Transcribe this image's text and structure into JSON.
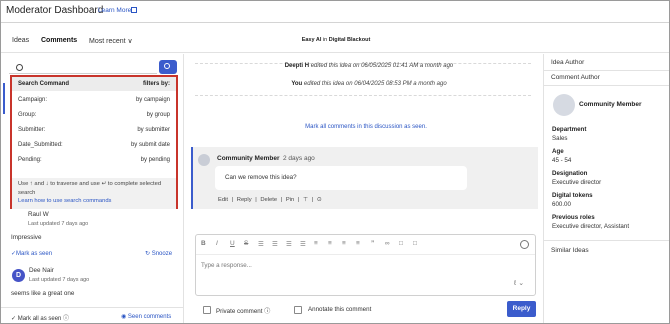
{
  "header": {
    "title": "Moderator Dashboard",
    "learn_more": "Learn More"
  },
  "tabs": {
    "ideas": "Ideas",
    "comments": "Comments",
    "sort": "Most recent ∨"
  },
  "document": {
    "owner": "Easy AI",
    "separator": "in",
    "title": "Digital Blackout"
  },
  "search_dropdown": {
    "header_left": "Search Command",
    "header_right": "filters by:",
    "rows": [
      {
        "command": "Campaign:",
        "filter": "by campaign"
      },
      {
        "command": "Group:",
        "filter": "by group"
      },
      {
        "command": "Submitter:",
        "filter": "by submitter"
      },
      {
        "command": "Date_Submitted:",
        "filter": "by submit date"
      },
      {
        "command": "Pending:",
        "filter": "by pending"
      }
    ],
    "hint": "Use ↑ and ↓ to traverse and use ↵ to complete selected search",
    "learn_link": "Learn how to use search commands"
  },
  "left_list": {
    "item1_name": "Raul W",
    "item1_updated": "Last updated 7 days ago",
    "item1_text": "Impressive",
    "mark_seen": "Mark as seen",
    "snooze": "Snooze",
    "item2_initial": "D",
    "item2_name": "Dee Nair",
    "item2_updated": "Last updated 7 days ago",
    "item2_text": "seems like a great one",
    "mark_all_seen": "Mark all as seen",
    "seen_comments": "Seen comments"
  },
  "activity": [
    {
      "who": "Deepti H",
      "text": "edited this idea on 06/05/2025 01:41 AM a month ago"
    },
    {
      "who": "You",
      "text": "edited this idea on 06/04/2025 08:53 PM a month ago"
    }
  ],
  "mark_all_discussion": "Mark all comments in this discussion as seen.",
  "comment": {
    "author": "Community Member",
    "time": "2 days ago",
    "text": "Can we remove this idea?",
    "actions": [
      "Edit",
      "|",
      "Reply",
      "|",
      "Delete",
      "|",
      "Pin",
      "|",
      "⊤",
      "|",
      "⊙"
    ]
  },
  "editor": {
    "placeholder": "Type a response...",
    "toolbar": [
      "B",
      "I",
      "U",
      "S",
      "☰",
      "☰",
      "☰",
      "☰",
      "≡",
      "≡",
      "≡",
      "≡",
      "”",
      "∞",
      "□",
      "□"
    ]
  },
  "options": {
    "private_comment": "Private comment",
    "annotate": "Annotate this comment",
    "reply": "Reply"
  },
  "right_panel": {
    "idea_author": "Idea Author",
    "comment_author": "Comment Author",
    "member_name": "Community Member",
    "fields": [
      {
        "label": "Department",
        "value": "Sales"
      },
      {
        "label": "Age",
        "value": "45 - 54"
      },
      {
        "label": "Designation",
        "value": "Executive director"
      },
      {
        "label": "Digital tokens",
        "value": "600.00"
      },
      {
        "label": "Previous roles",
        "value": "Executive director, Assistant"
      }
    ],
    "similar_ideas": "Similar Ideas"
  },
  "colors": {
    "accent": "#3b5ccc",
    "highlight_border": "#c8342b",
    "link": "#2a55c4"
  }
}
